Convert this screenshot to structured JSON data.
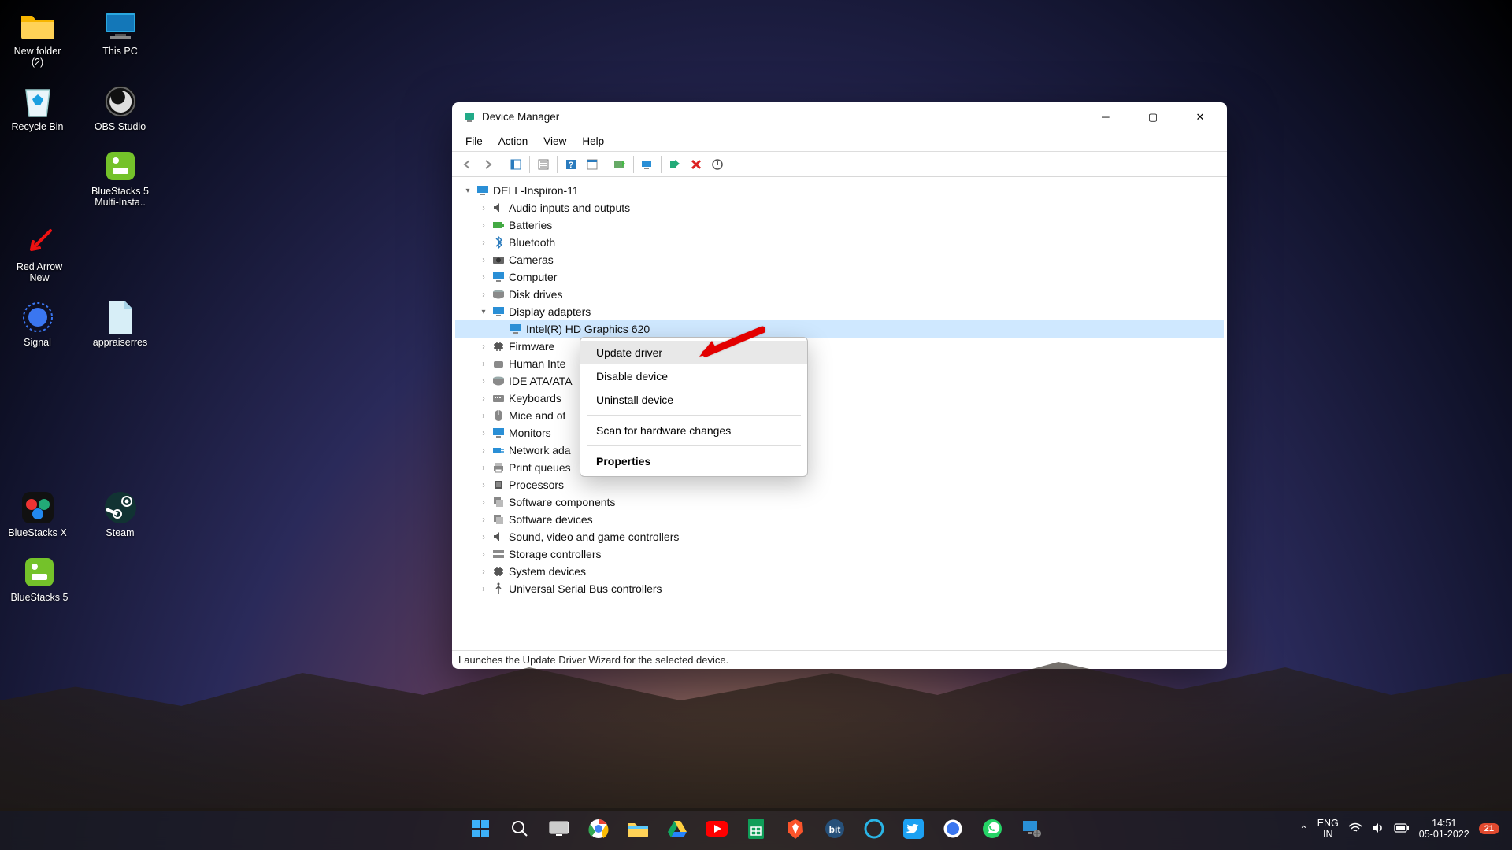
{
  "desktop": {
    "icons": [
      {
        "id": "new-folder",
        "label": "New folder (2)",
        "glyph": "folder"
      },
      {
        "id": "this-pc",
        "label": "This PC",
        "glyph": "pc"
      },
      {
        "id": "recycle-bin",
        "label": "Recycle Bin",
        "glyph": "recycle"
      },
      {
        "id": "obs-studio",
        "label": "OBS Studio",
        "glyph": "obs"
      },
      {
        "id": "bluestacks5-multi",
        "label": "BlueStacks 5 Multi-Insta..",
        "glyph": "bluestacks"
      },
      {
        "id": "red-arrow-new",
        "label": "Red Arrow New",
        "glyph": "redarrow"
      },
      {
        "id": "signal",
        "label": "Signal",
        "glyph": "signal"
      },
      {
        "id": "appraiserres",
        "label": "appraiserres",
        "glyph": "file"
      },
      {
        "id": "bluestacks-x",
        "label": "BlueStacks X",
        "glyph": "bsx"
      },
      {
        "id": "steam",
        "label": "Steam",
        "glyph": "steam"
      },
      {
        "id": "bluestacks5",
        "label": "BlueStacks 5",
        "glyph": "bluestacks"
      }
    ]
  },
  "window": {
    "title": "Device Manager",
    "menu": [
      "File",
      "Action",
      "View",
      "Help"
    ],
    "root": "DELL-Inspiron-11",
    "selected_device": "Intel(R) HD Graphics 620",
    "categories": [
      {
        "name": "Audio inputs and outputs",
        "icon": "speaker"
      },
      {
        "name": "Batteries",
        "icon": "battery"
      },
      {
        "name": "Bluetooth",
        "icon": "bt"
      },
      {
        "name": "Cameras",
        "icon": "camera"
      },
      {
        "name": "Computer",
        "icon": "monitor"
      },
      {
        "name": "Disk drives",
        "icon": "disk"
      },
      {
        "name": "Display adapters",
        "icon": "monitor",
        "expanded": true,
        "children": [
          {
            "name": "Intel(R) HD Graphics 620",
            "icon": "monitor",
            "selected": true
          }
        ]
      },
      {
        "name": "Firmware",
        "icon": "chip",
        "truncated": true
      },
      {
        "name": "Human Interface Devices",
        "icon": "hid",
        "truncated": true,
        "truncLabel": "Human Inte"
      },
      {
        "name": "IDE ATA/ATAPI controllers",
        "icon": "disk",
        "truncated": true,
        "truncLabel": "IDE ATA/ATAI"
      },
      {
        "name": "Keyboards",
        "icon": "keyboard",
        "truncated": true
      },
      {
        "name": "Mice and other pointing devices",
        "icon": "mouse",
        "truncated": true,
        "truncLabel": "Mice and ot"
      },
      {
        "name": "Monitors",
        "icon": "monitor",
        "truncated": true
      },
      {
        "name": "Network adapters",
        "icon": "network",
        "truncated": true,
        "truncLabel": "Network ada"
      },
      {
        "name": "Print queues",
        "icon": "printer"
      },
      {
        "name": "Processors",
        "icon": "cpu"
      },
      {
        "name": "Software components",
        "icon": "sw"
      },
      {
        "name": "Software devices",
        "icon": "sw"
      },
      {
        "name": "Sound, video and game controllers",
        "icon": "speaker"
      },
      {
        "name": "Storage controllers",
        "icon": "storage"
      },
      {
        "name": "System devices",
        "icon": "chip"
      },
      {
        "name": "Universal Serial Bus controllers",
        "icon": "usb"
      }
    ],
    "status": "Launches the Update Driver Wizard for the selected device."
  },
  "context_menu": {
    "items": [
      {
        "label": "Update driver",
        "highlight": true
      },
      {
        "label": "Disable device"
      },
      {
        "label": "Uninstall device"
      },
      {
        "sep": true
      },
      {
        "label": "Scan for hardware changes"
      },
      {
        "sep": true
      },
      {
        "label": "Properties",
        "bold": true
      }
    ]
  },
  "taskbar": {
    "apps": [
      "start",
      "search",
      "taskview",
      "chrome",
      "explorer",
      "drive",
      "youtube",
      "sheets",
      "brave",
      "bitwarden",
      "cortana",
      "twitter",
      "signal",
      "whatsapp",
      "devmgr"
    ],
    "tray": {
      "chevron": "⌃",
      "lang_top": "ENG",
      "lang_bot": "IN",
      "time": "14:51",
      "date": "05-01-2022",
      "badge": "21"
    }
  }
}
